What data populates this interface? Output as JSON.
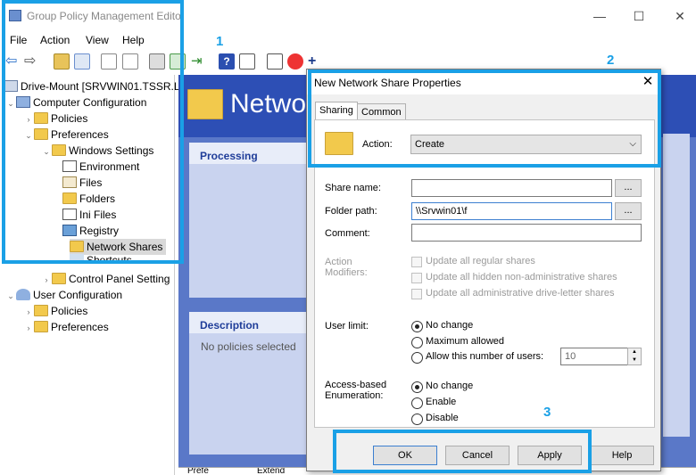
{
  "window": {
    "title": "Group Policy Management Edito",
    "minimize": "—",
    "maximize": "☐",
    "close": "✕"
  },
  "menu": [
    "File",
    "Action",
    "View",
    "Help"
  ],
  "tree": {
    "root": "Drive-Mount [SRVWIN01.TSSR.L",
    "computer_config": "Computer Configuration",
    "policies": "Policies",
    "preferences": "Preferences",
    "windows_settings": "Windows Settings",
    "environment": "Environment",
    "files": "Files",
    "folders": "Folders",
    "ini_files": "Ini Files",
    "registry": "Registry",
    "network_shares": "Network Shares",
    "shortcuts": "Shortcuts",
    "control_panel": "Control Panel Setting",
    "user_config": "User Configuration",
    "user_policies": "Policies",
    "user_preferences": "Preferences"
  },
  "right_panel": {
    "title": "Netwo",
    "processing": "Processing",
    "description": "Description",
    "no_policies": "No policies selected",
    "bottom_tab1": "Prefe",
    "bottom_tab2": "Extend"
  },
  "dialog": {
    "title": "New Network Share Properties",
    "close": "✕",
    "tabs": [
      "Sharing",
      "Common"
    ],
    "action_label": "Action:",
    "action_value": "Create",
    "share_name_label": "Share name:",
    "share_name_value": "",
    "folder_path_label": "Folder path:",
    "folder_path_value": "\\\\Srvwin01\\f",
    "comment_label": "Comment:",
    "comment_value": "",
    "browse": "...",
    "action_modifiers_label": "Action\nModifiers:",
    "modifiers": [
      "Update all regular shares",
      "Update all hidden non-administrative shares",
      "Update all administrative drive-letter shares"
    ],
    "user_limit_label": "User limit:",
    "user_limit_options": [
      "No change",
      "Maximum allowed",
      "Allow this number of users:"
    ],
    "user_count": "10",
    "abe_label": "Access-based\nEnumeration:",
    "abe_options": [
      "No change",
      "Enable",
      "Disable"
    ],
    "buttons": {
      "ok": "OK",
      "cancel": "Cancel",
      "apply": "Apply",
      "help": "Help"
    }
  },
  "callouts": [
    "1",
    "2",
    "3"
  ],
  "colors": {
    "callout": "#1aa0e6",
    "panel_header": "#2d4fb5",
    "panel_body": "#5a78c8",
    "folder": "#f2c94c"
  }
}
